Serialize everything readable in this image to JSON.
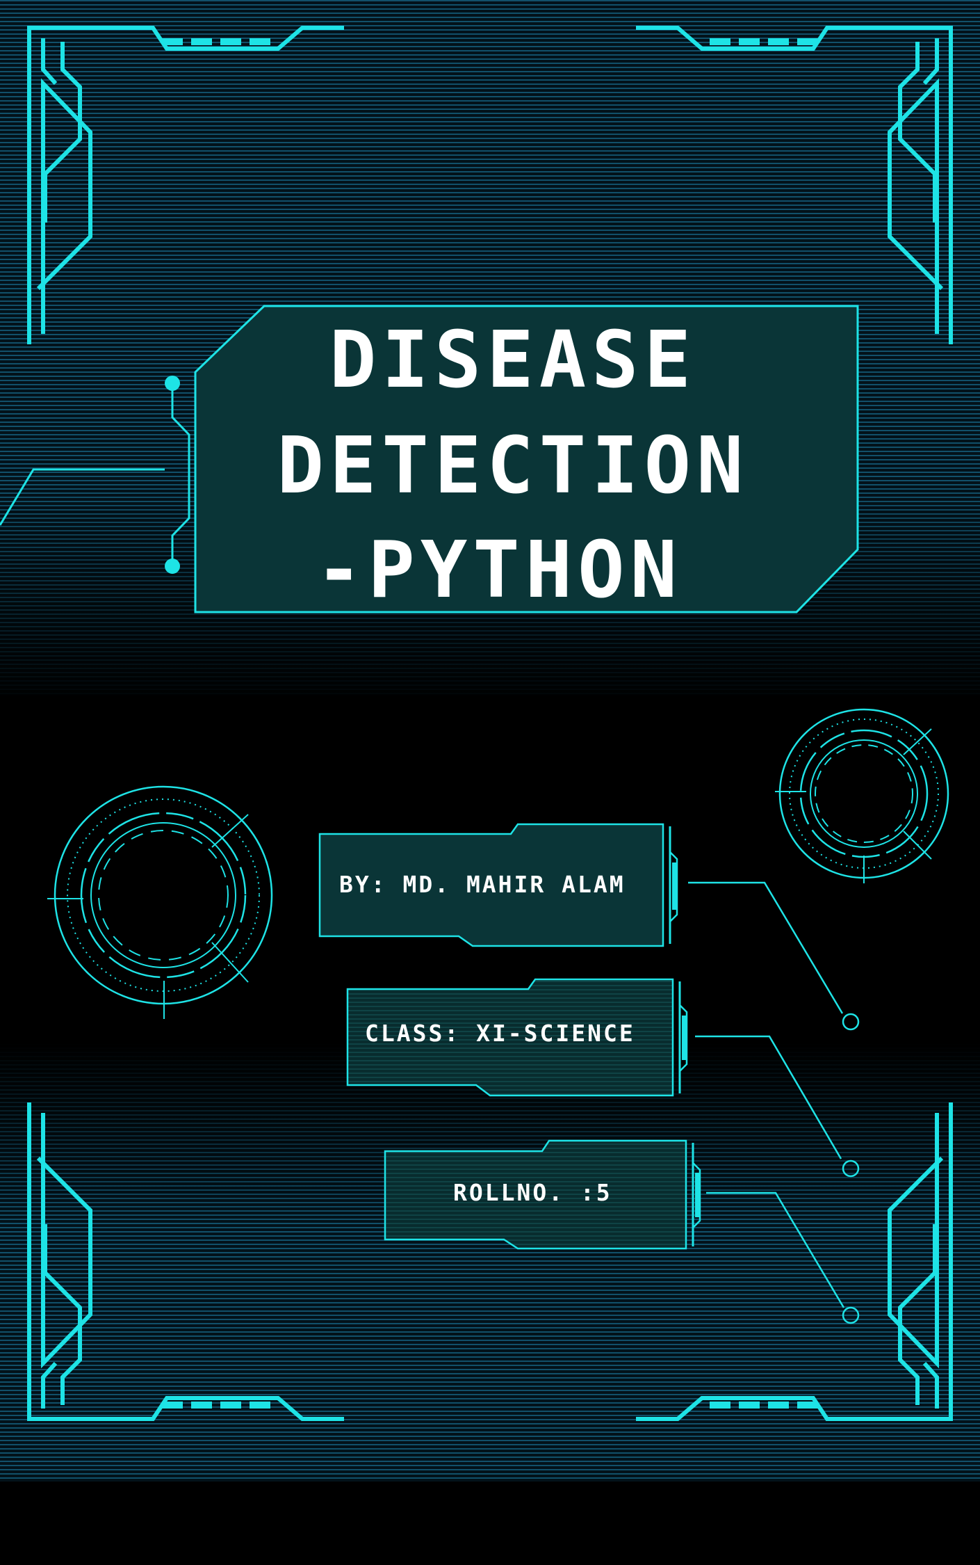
{
  "colors": {
    "background": "#000000",
    "accent": "#1ee3e6",
    "panel_fill": "#0c3a3c",
    "stripe": "#0f4a5c",
    "text": "#ffffff"
  },
  "title": {
    "line1": "DISEASE",
    "line2": "DETECTION",
    "line3": "-PYTHON"
  },
  "info": {
    "author": "BY: MD. MAHIR ALAM",
    "class": "CLASS: XI-SCIENCE",
    "roll": "ROLLNO. :5"
  },
  "decorations": [
    "corner-frame-icon",
    "hud-circle-icon",
    "connector-dot-icon"
  ]
}
